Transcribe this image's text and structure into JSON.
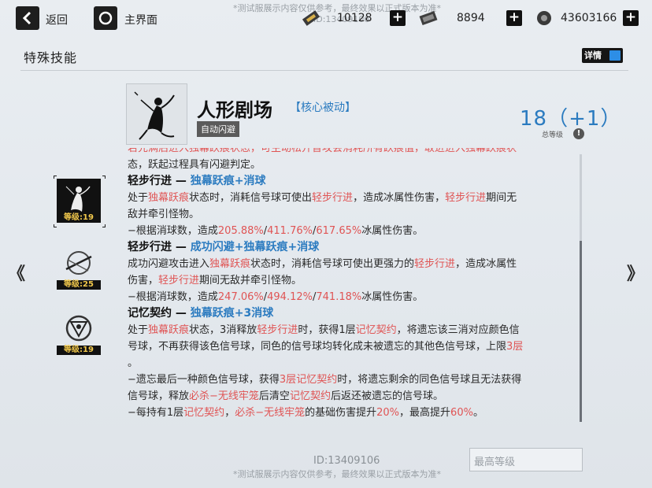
{
  "topbar": {
    "back_label": "返回",
    "home_label": "主界面",
    "watermark": "*测试服展示内容仅供参考，最终效果以正式版本为准*",
    "watermark_id": "ID:13409106",
    "resources": [
      {
        "icon": "ticket-icon",
        "value": "10128"
      },
      {
        "icon": "battery-icon",
        "value": "8894"
      },
      {
        "icon": "gear-coin-icon",
        "value": "43603166"
      }
    ],
    "plus_symbol": "+"
  },
  "section": {
    "title": "特殊技能",
    "detail_toggle_label": "详情"
  },
  "skill": {
    "name": "人形剧场",
    "type": "【核心被动】",
    "tag": "自动闪避",
    "level": "18（+1）",
    "level_label": "总等级",
    "info_symbol": "!"
  },
  "nodes": [
    {
      "level_label": "等级:19",
      "selected": true
    },
    {
      "level_label": "等级:25",
      "selected": false
    },
    {
      "level_label": "等级:19",
      "selected": false
    }
  ],
  "body": {
    "l0": [
      "若先满后进入独幕跃痕状态，可主动松开普攻会消耗所有跃痕值，取进进入独幕跃痕状",
      ""
    ],
    "l1": "态，跃起过程具有闪避判定。",
    "s1_head": "轻步行进 — ",
    "s1_head_b": "独幕跃痕+消球",
    "s1_a1": "处于",
    "s1_a2": "独幕跃痕",
    "s1_a3": "状态时，消耗信号球可使出",
    "s1_a4": "轻步行进",
    "s1_a5": "，造成冰属性伤害，",
    "s1_a6": "轻步行进",
    "s1_a7": "期间无",
    "s1_b": "敌并牵引怪物。",
    "s1_c1": "−根据消球数，造成",
    "s1_c2": "205.88%",
    "s1_c3": "/",
    "s1_c4": "411.76%",
    "s1_c5": "/",
    "s1_c6": "617.65%",
    "s1_c7": "冰属性伤害。",
    "s2_head": "轻步行进 — ",
    "s2_head_b": "成功闪避+独幕跃痕+消球",
    "s2_a1": "成功闪避攻击进入",
    "s2_a2": "独幕跃痕",
    "s2_a3": "状态时，消耗信号球可使出更强力的",
    "s2_a4": "轻步行进",
    "s2_a5": "，造成冰属性",
    "s2_b1": "伤害，",
    "s2_b2": "轻步行进",
    "s2_b3": "期间无敌并牵引怪物。",
    "s2_c1": "−根据消球数，造成",
    "s2_c2": "247.06%",
    "s2_c3": "/",
    "s2_c4": "494.12%",
    "s2_c5": "/",
    "s2_c6": "741.18%",
    "s2_c7": "冰属性伤害。",
    "s3_head": "记忆契约 — ",
    "s3_head_b": "独幕跃痕+3消球",
    "s3_a1": "处于",
    "s3_a2": "独幕跃痕",
    "s3_a3": "状态，3消释放",
    "s3_a4": "轻步行进",
    "s3_a5": "时，获得1层",
    "s3_a6": "记忆契约",
    "s3_a7": "，将遗忘该三消对应颜色信",
    "s3_b1": "号球，不再获得该色信号球，同色的信号球均转化成未被遗忘的其他色信号球，上限",
    "s3_b2": "3层",
    "s3_c": "。",
    "s3_d1": "−遗忘最后一种颜色信号球，获得",
    "s3_d2": "3层",
    "s3_d3": "记忆契约",
    "s3_d4": "时，将遗忘剩余的同色信号球且无法获得",
    "s3_e1": "信号球，释放",
    "s3_e2": "必杀−无线牢笼",
    "s3_e3": "后清空",
    "s3_e4": "记忆契约",
    "s3_e5": "后返还被遗忘的信号球。",
    "s3_f1": "−每持有1层",
    "s3_f2": "记忆契约",
    "s3_f3": "，",
    "s3_f4": "必杀−无线牢笼",
    "s3_f5": "的基础伤害提升",
    "s3_f6": "20%",
    "s3_f7": "，最高提升",
    "s3_f8": "60%",
    "s3_f9": "。"
  },
  "footer": {
    "id_text": "ID:13409106",
    "max_level_label": "最高等级",
    "watermark": "*测试服展示内容仅供参考，最终效果以正式版本为准*"
  },
  "nav": {
    "prev": "《",
    "next": "》"
  },
  "colors": {
    "accent_blue": "#2b7bc0",
    "highlight_red": "#e05454",
    "level_gold": "#f2c94c"
  }
}
